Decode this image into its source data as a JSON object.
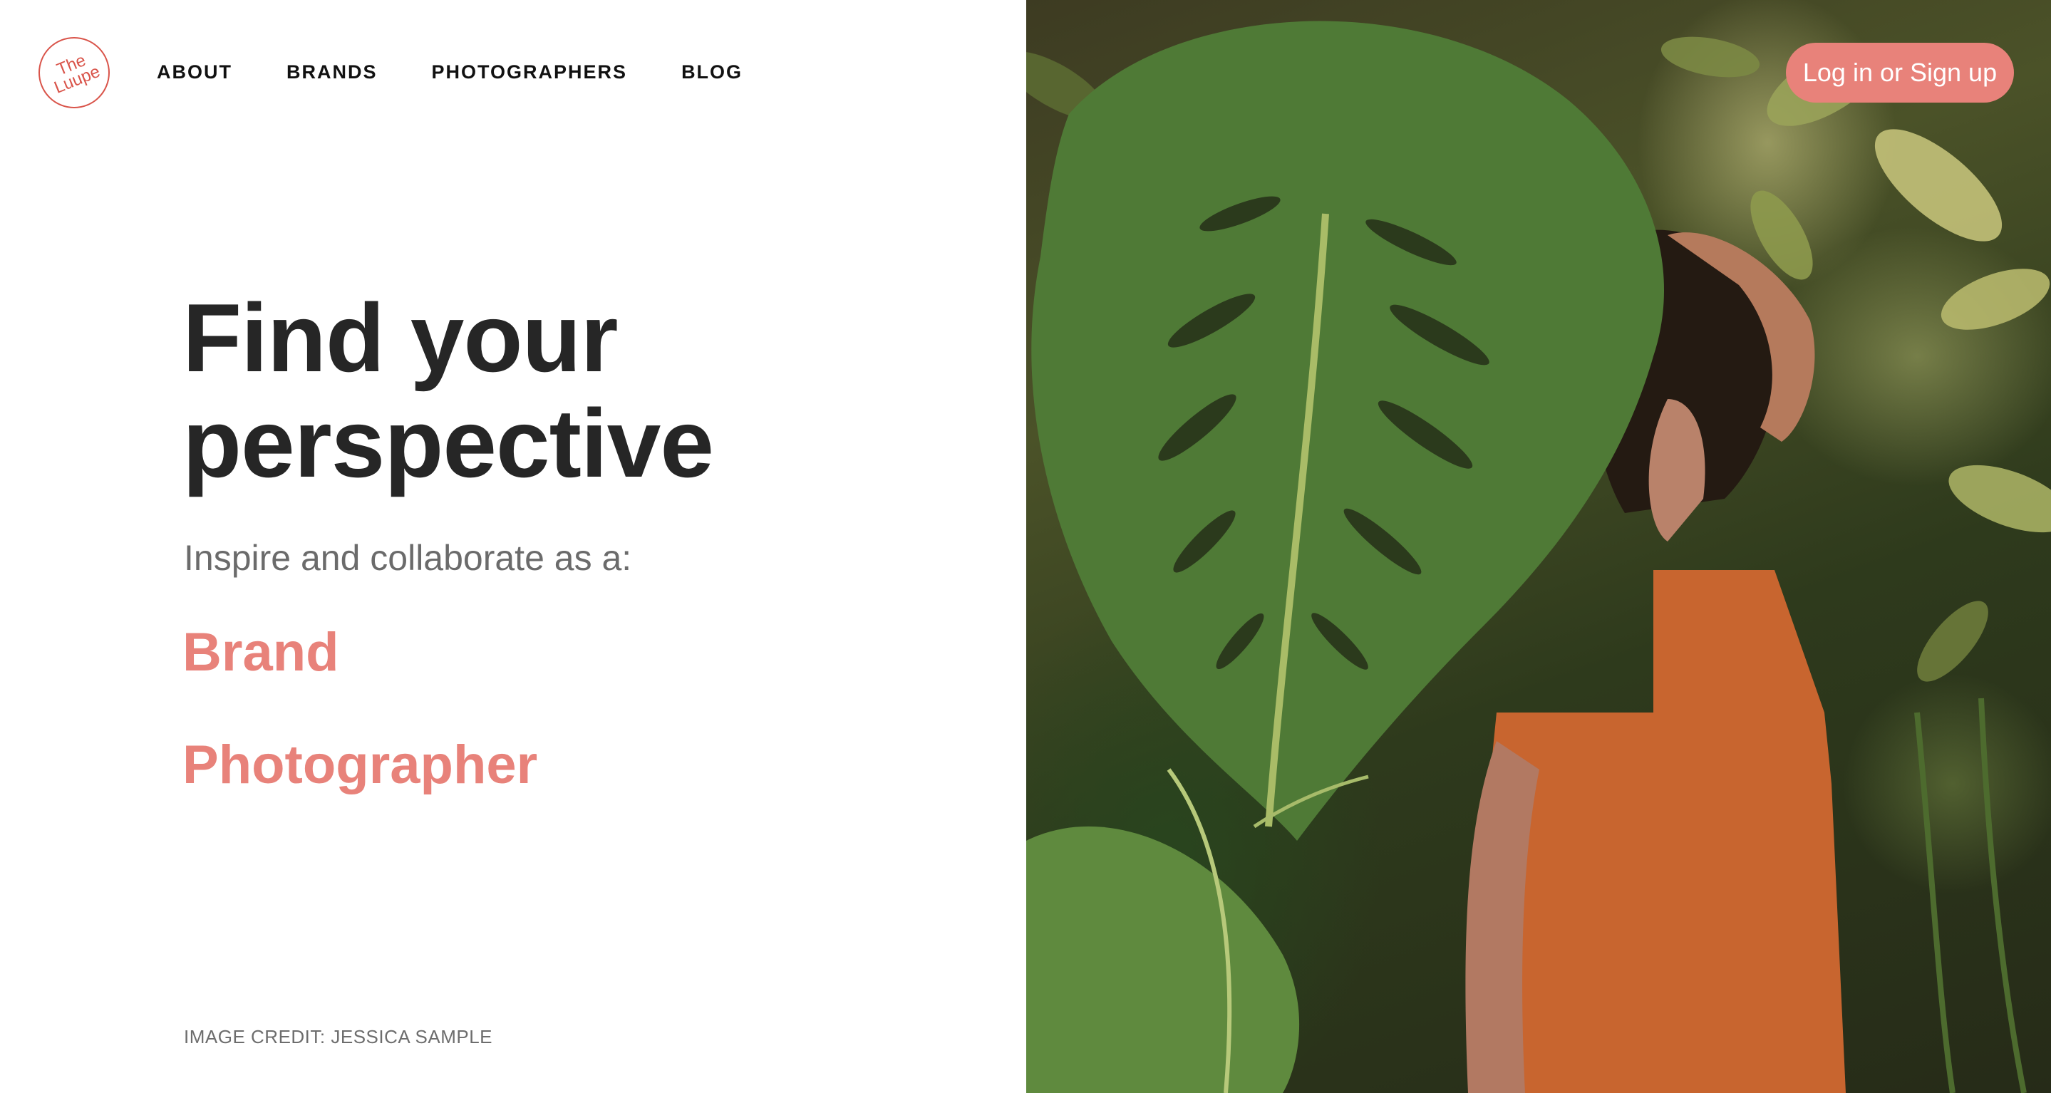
{
  "logo": {
    "text": "The\nLuupe"
  },
  "nav": {
    "items": [
      {
        "label": "ABOUT"
      },
      {
        "label": "BRANDS"
      },
      {
        "label": "PHOTOGRAPHERS"
      },
      {
        "label": "BLOG"
      }
    ]
  },
  "hero": {
    "title": "Find your\nperspective",
    "subtitle": "Inspire and collaborate as a:",
    "roles": [
      {
        "label": "Brand"
      },
      {
        "label": "Photographer"
      }
    ]
  },
  "credit": "IMAGE CREDIT: JESSICA SAMPLE",
  "header": {
    "login_label": "Log in or Sign up"
  },
  "colors": {
    "accent": "#e8827a",
    "logo": "#d9544a",
    "title": "#262626",
    "subtitle": "#6b6b6b"
  }
}
